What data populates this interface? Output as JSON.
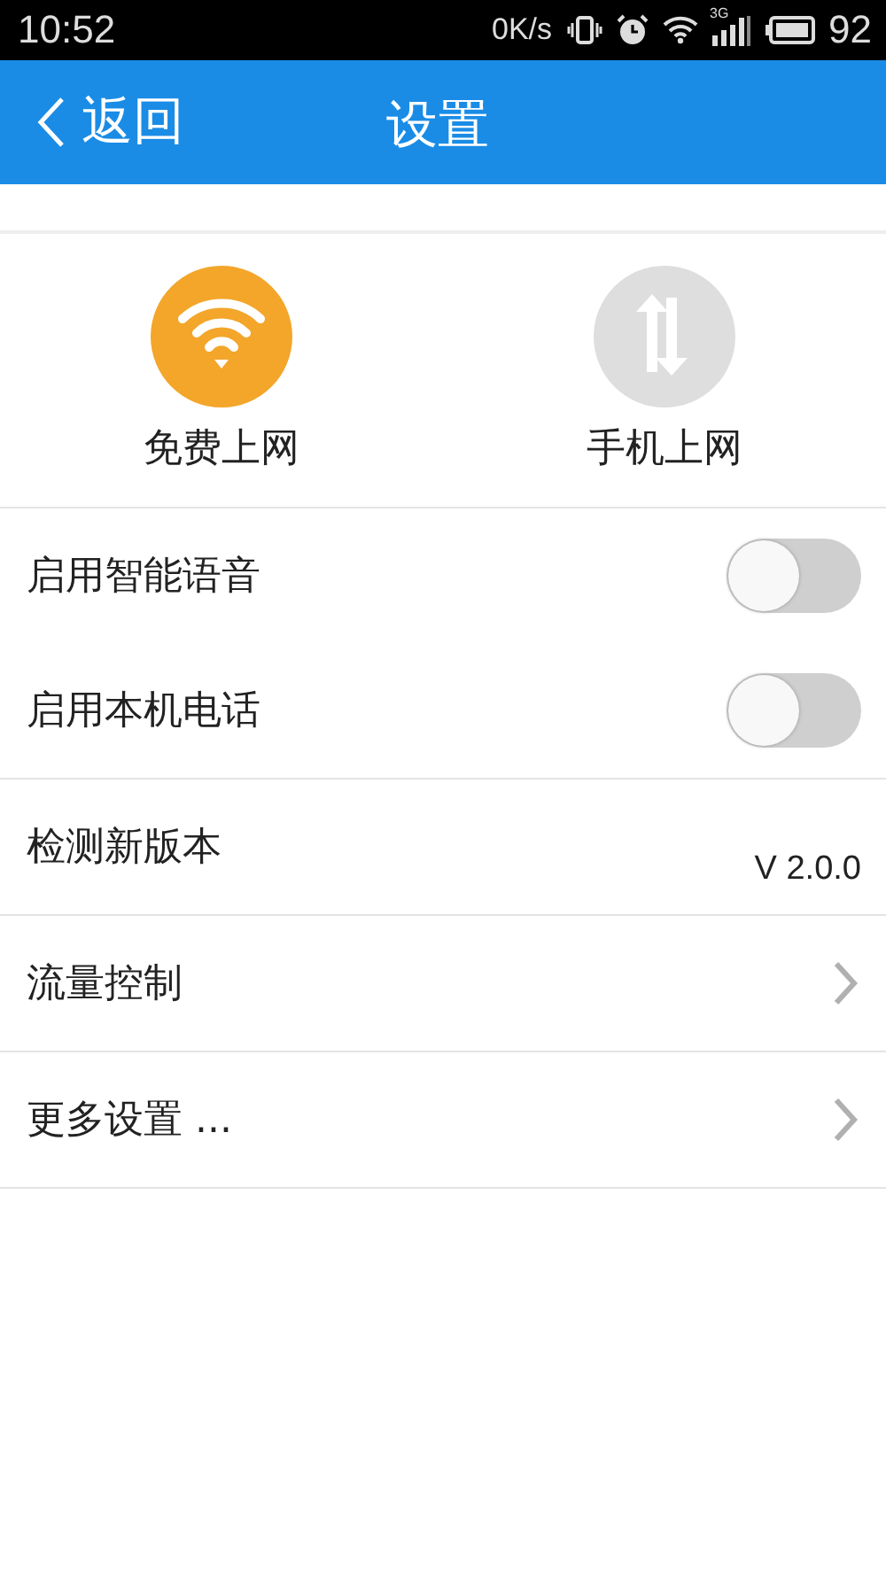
{
  "status_bar": {
    "time": "10:52",
    "net_speed": "0K/s",
    "network_type": "3G",
    "battery": "92"
  },
  "nav": {
    "back": "返回",
    "title": "设置"
  },
  "modes": [
    {
      "kind": "wifi",
      "label": "免费上网",
      "selected": true
    },
    {
      "kind": "data",
      "label": "手机上网",
      "selected": false
    }
  ],
  "rows": [
    {
      "kind": "toggle",
      "label": "启用智能语音",
      "on": false
    },
    {
      "kind": "toggle",
      "label": "启用本机电话",
      "on": false
    },
    {
      "kind": "value",
      "label": "检测新版本",
      "value": "V 2.0.0"
    },
    {
      "kind": "link",
      "label": "流量控制"
    },
    {
      "kind": "link",
      "label": "更多设置 ..."
    }
  ]
}
